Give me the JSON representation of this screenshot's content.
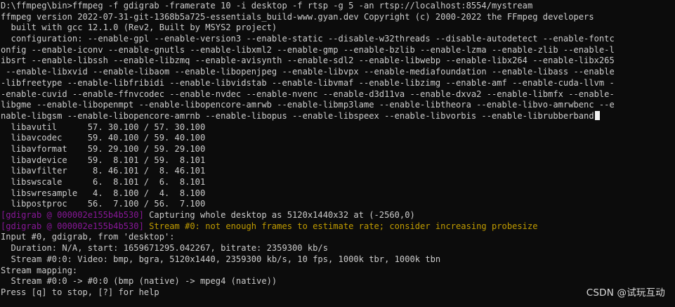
{
  "terminal": {
    "background": "#0c0c0c",
    "colors": {
      "normal": "#cccccc",
      "tag": "#881798",
      "warning": "#c19c00",
      "cursor": "#f2f2f2"
    },
    "cursor_line_index": 10,
    "lines": [
      {
        "segments": [
          {
            "text": "D:\\ffmpeg\\bin>ffmpeg -f gdigrab -framerate 10 -i desktop -f rtsp -g 5 -an rtsp://localhost:8554/mystream",
            "style": "normal"
          }
        ]
      },
      {
        "segments": [
          {
            "text": "ffmpeg version 2022-07-31-git-1368b5a725-essentials_build-www.gyan.dev Copyright (c) 2000-2022 the FFmpeg developers",
            "style": "normal"
          }
        ]
      },
      {
        "segments": [
          {
            "text": "  built with gcc 12.1.0 (Rev2, Built by MSYS2 project)",
            "style": "normal"
          }
        ]
      },
      {
        "segments": [
          {
            "text": "  configuration: --enable-gpl --enable-version3 --enable-static --disable-w32threads --disable-autodetect --enable-fontc",
            "style": "normal"
          }
        ]
      },
      {
        "segments": [
          {
            "text": "onfig --enable-iconv --enable-gnutls --enable-libxml2 --enable-gmp --enable-bzlib --enable-lzma --enable-zlib --enable-l",
            "style": "normal"
          }
        ]
      },
      {
        "segments": [
          {
            "text": "ibsrt --enable-libssh --enable-libzmq --enable-avisynth --enable-sdl2 --enable-libwebp --enable-libx264 --enable-libx265",
            "style": "normal"
          }
        ]
      },
      {
        "segments": [
          {
            "text": " --enable-libxvid --enable-libaom --enable-libopenjpeg --enable-libvpx --enable-mediafoundation --enable-libass --enable",
            "style": "normal"
          }
        ]
      },
      {
        "segments": [
          {
            "text": "-libfreetype --enable-libfribidi --enable-libvidstab --enable-libvmaf --enable-libzimg --enable-amf --enable-cuda-llvm -",
            "style": "normal"
          }
        ]
      },
      {
        "segments": [
          {
            "text": "-enable-cuvid --enable-ffnvcodec --enable-nvdec --enable-nvenc --enable-d3d11va --enable-dxva2 --enable-libmfx --enable-",
            "style": "normal"
          }
        ]
      },
      {
        "segments": [
          {
            "text": "libgme --enable-libopenmpt --enable-libopencore-amrwb --enable-libmp3lame --enable-libtheora --enable-libvo-amrwbenc --e",
            "style": "normal"
          }
        ]
      },
      {
        "segments": [
          {
            "text": "nable-libgsm --enable-libopencore-amrnb --enable-libopus --enable-libspeex --enable-libvorbis --enable-librubberband",
            "style": "normal"
          }
        ]
      },
      {
        "segments": [
          {
            "text": "  libavutil      57. 30.100 / 57. 30.100",
            "style": "normal"
          }
        ]
      },
      {
        "segments": [
          {
            "text": "  libavcodec     59. 40.100 / 59. 40.100",
            "style": "normal"
          }
        ]
      },
      {
        "segments": [
          {
            "text": "  libavformat    59. 29.100 / 59. 29.100",
            "style": "normal"
          }
        ]
      },
      {
        "segments": [
          {
            "text": "  libavdevice    59.  8.101 / 59.  8.101",
            "style": "normal"
          }
        ]
      },
      {
        "segments": [
          {
            "text": "  libavfilter     8. 46.101 /  8. 46.101",
            "style": "normal"
          }
        ]
      },
      {
        "segments": [
          {
            "text": "  libswscale      6.  8.101 /  6.  8.101",
            "style": "normal"
          }
        ]
      },
      {
        "segments": [
          {
            "text": "  libswresample   4.  8.100 /  4.  8.100",
            "style": "normal"
          }
        ]
      },
      {
        "segments": [
          {
            "text": "  libpostproc    56.  7.100 / 56.  7.100",
            "style": "normal"
          }
        ]
      },
      {
        "segments": [
          {
            "text": "[gdigrab @ 000002e155b4b530] ",
            "style": "tag"
          },
          {
            "text": "Capturing whole desktop as 5120x1440x32 at (-2560,0)",
            "style": "normal"
          }
        ]
      },
      {
        "segments": [
          {
            "text": "[gdigrab @ 000002e155b4b530] ",
            "style": "tag"
          },
          {
            "text": "Stream #0: not enough frames to estimate rate; consider increasing probesize",
            "style": "warning"
          }
        ]
      },
      {
        "segments": [
          {
            "text": "Input #0, gdigrab, from 'desktop':",
            "style": "normal"
          }
        ]
      },
      {
        "segments": [
          {
            "text": "  Duration: N/A, start: 1659671295.042267, bitrate: 2359300 kb/s",
            "style": "normal"
          }
        ]
      },
      {
        "segments": [
          {
            "text": "  Stream #0:0: Video: bmp, bgra, 5120x1440, 2359300 kb/s, 10 fps, 1000k tbr, 1000k tbn",
            "style": "normal"
          }
        ]
      },
      {
        "segments": [
          {
            "text": "Stream mapping:",
            "style": "normal"
          }
        ]
      },
      {
        "segments": [
          {
            "text": "  Stream #0:0 -> #0:0 (bmp (native) -> mpeg4 (native))",
            "style": "normal"
          }
        ]
      },
      {
        "segments": [
          {
            "text": "Press [q] to stop, [?] for help",
            "style": "normal"
          }
        ]
      }
    ]
  },
  "watermark": {
    "text": "CSDN @试玩互动"
  }
}
